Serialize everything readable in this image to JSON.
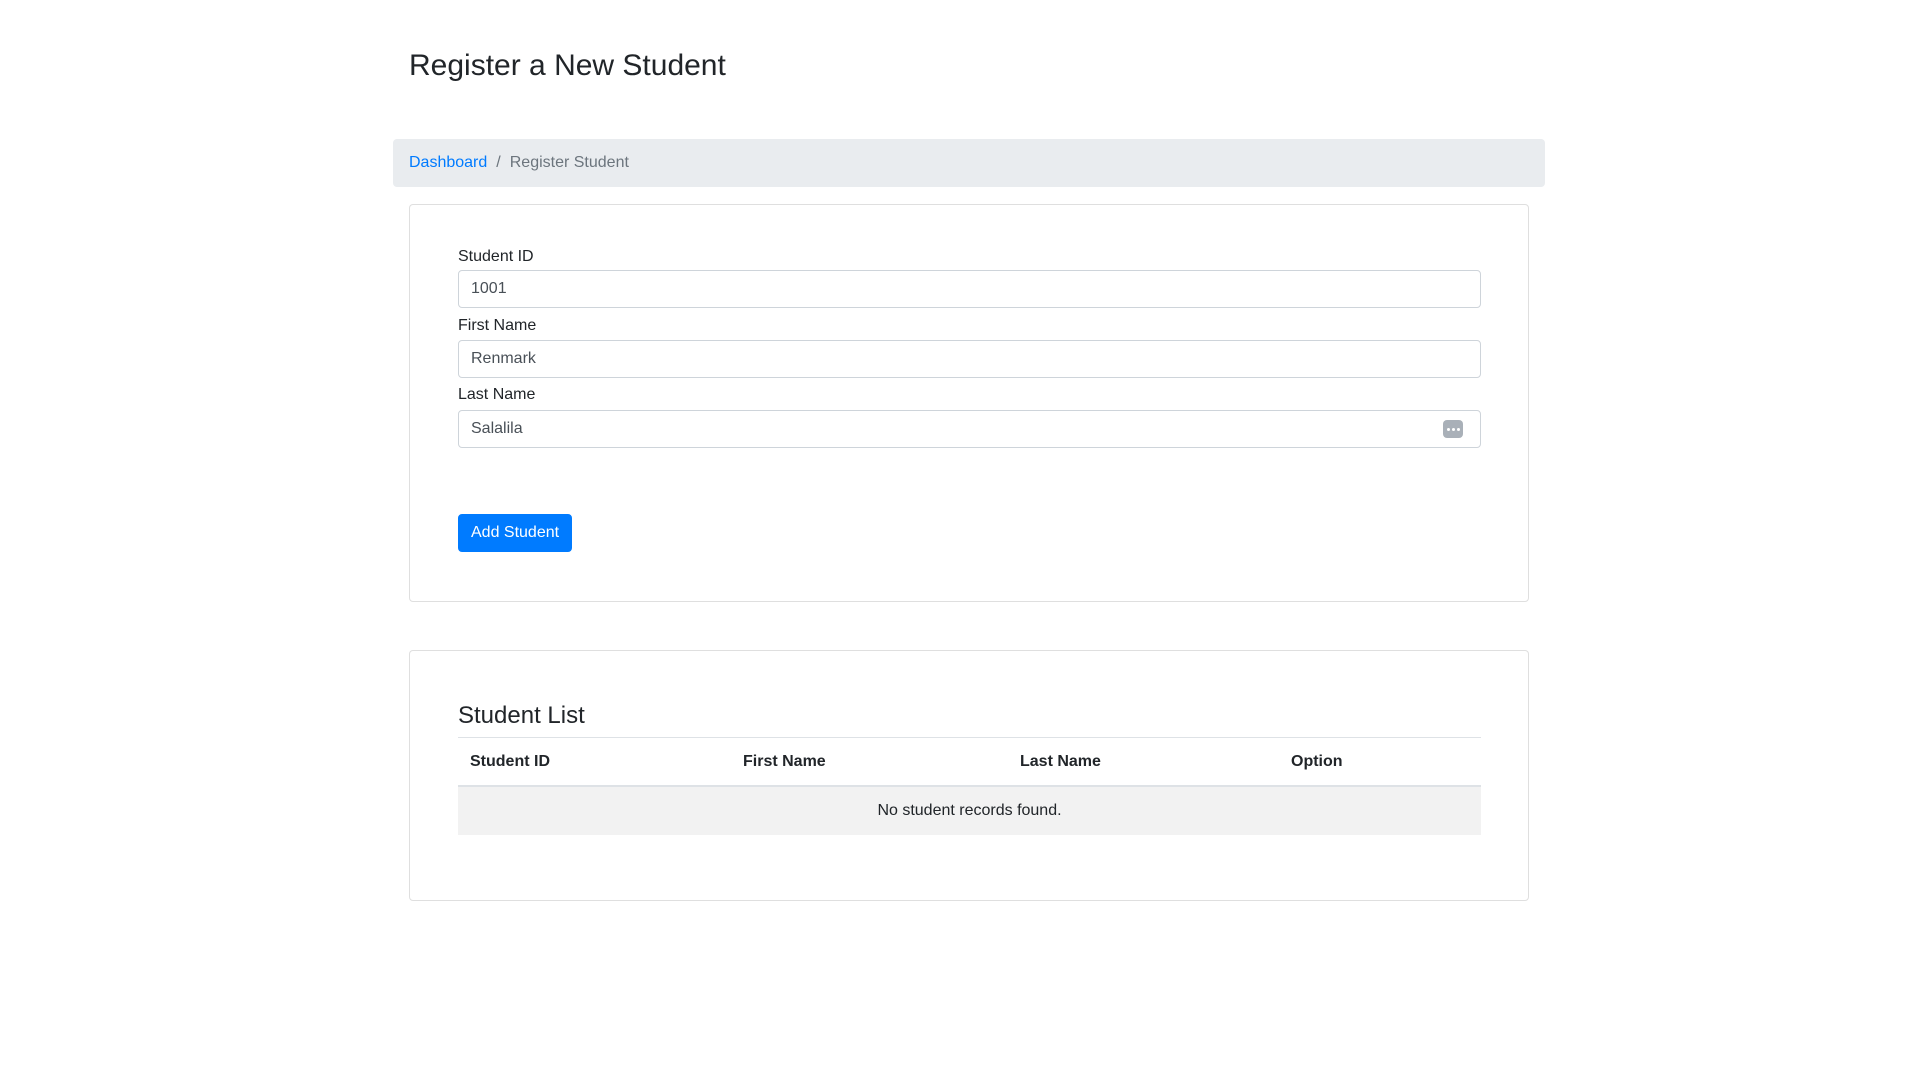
{
  "header": {
    "title": "Register a New Student"
  },
  "breadcrumb": {
    "items": [
      {
        "label": "Dashboard"
      },
      {
        "label": "Register Student"
      }
    ],
    "separator": "/"
  },
  "form": {
    "fields": [
      {
        "label": "Student ID",
        "value": "1001"
      },
      {
        "label": "First Name",
        "value": "Renmark"
      },
      {
        "label": "Last Name",
        "value": "Salalila"
      }
    ],
    "submit_label": "Add Student"
  },
  "student_list": {
    "title": "Student List",
    "columns": [
      "Student ID",
      "First Name",
      "Last Name",
      "Option"
    ],
    "empty_message": "No student records found."
  },
  "colors": {
    "primary": "#007bff",
    "breadcrumb_bg": "#e9ecef",
    "muted": "#6c757d",
    "empty_row_bg": "#f2f2f2"
  },
  "icons": {
    "autofill": "password-manager-dots-icon"
  }
}
